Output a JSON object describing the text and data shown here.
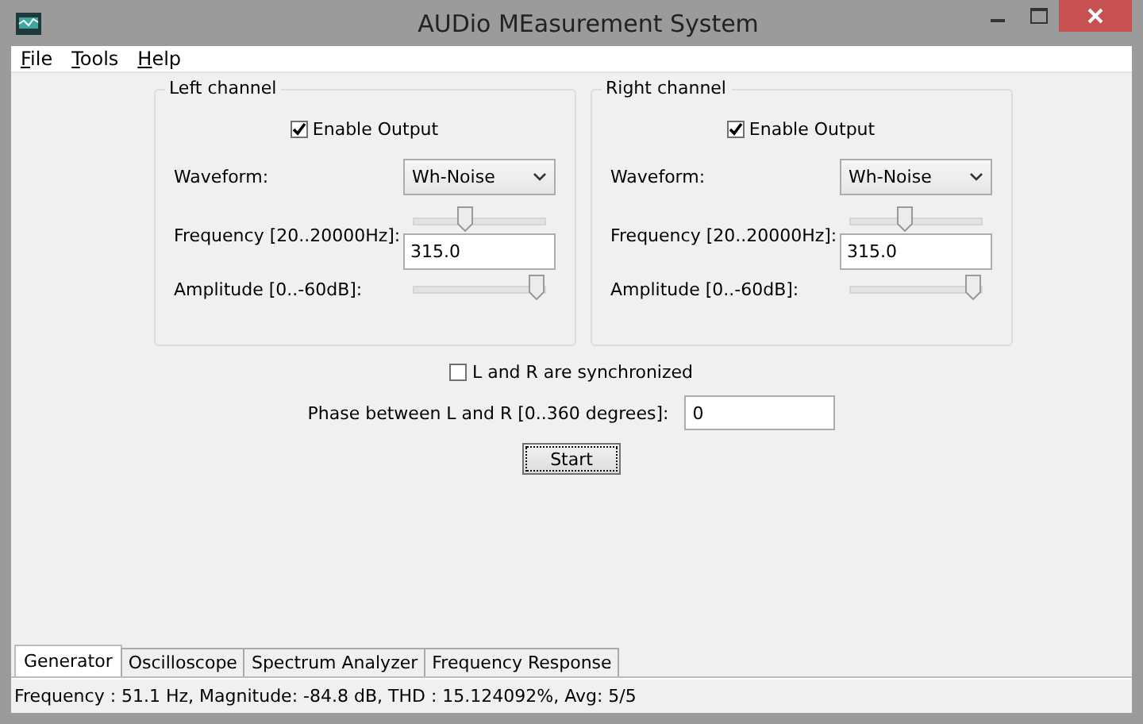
{
  "window": {
    "title": "AUDio MEasurement System"
  },
  "menu": [
    {
      "label": "File"
    },
    {
      "label": "Tools"
    },
    {
      "label": "Help"
    }
  ],
  "channels": [
    {
      "title": "Left channel",
      "enable_label": "Enable Output",
      "enabled": true,
      "waveform_label": "Waveform:",
      "waveform": "Wh-Noise",
      "frequency_label": "Frequency [20..20000Hz]:",
      "frequency_slider": {
        "level": 0.4
      },
      "frequency": "315.0",
      "amplitude_label": "Amplitude [0..-60dB]:",
      "amplitude_slider": {
        "level": 0.95
      }
    },
    {
      "title": "Right channel",
      "enable_label": "Enable Output",
      "enabled": true,
      "waveform_label": "Waveform:",
      "waveform": "Wh-Noise",
      "frequency_label": "Frequency [20..20000Hz]:",
      "frequency_slider": {
        "level": 0.42
      },
      "frequency": "315.0",
      "amplitude_label": "Amplitude [0..-60dB]:",
      "amplitude_slider": {
        "level": 0.95
      }
    }
  ],
  "sync": {
    "label": "L and R are synchronized",
    "checked": false
  },
  "phase": {
    "label": "Phase between L and R [0..360 degrees]:",
    "value": "0"
  },
  "start_button": "Start",
  "tabs": [
    {
      "label": "Generator",
      "selected": true
    },
    {
      "label": "Oscilloscope",
      "selected": false
    },
    {
      "label": "Spectrum Analyzer",
      "selected": false
    },
    {
      "label": "Frequency Response",
      "selected": false
    }
  ],
  "status_bar": "Frequency : 51.1 Hz, Magnitude: -84.8 dB, THD : 15.124092%, Avg: 5/5"
}
